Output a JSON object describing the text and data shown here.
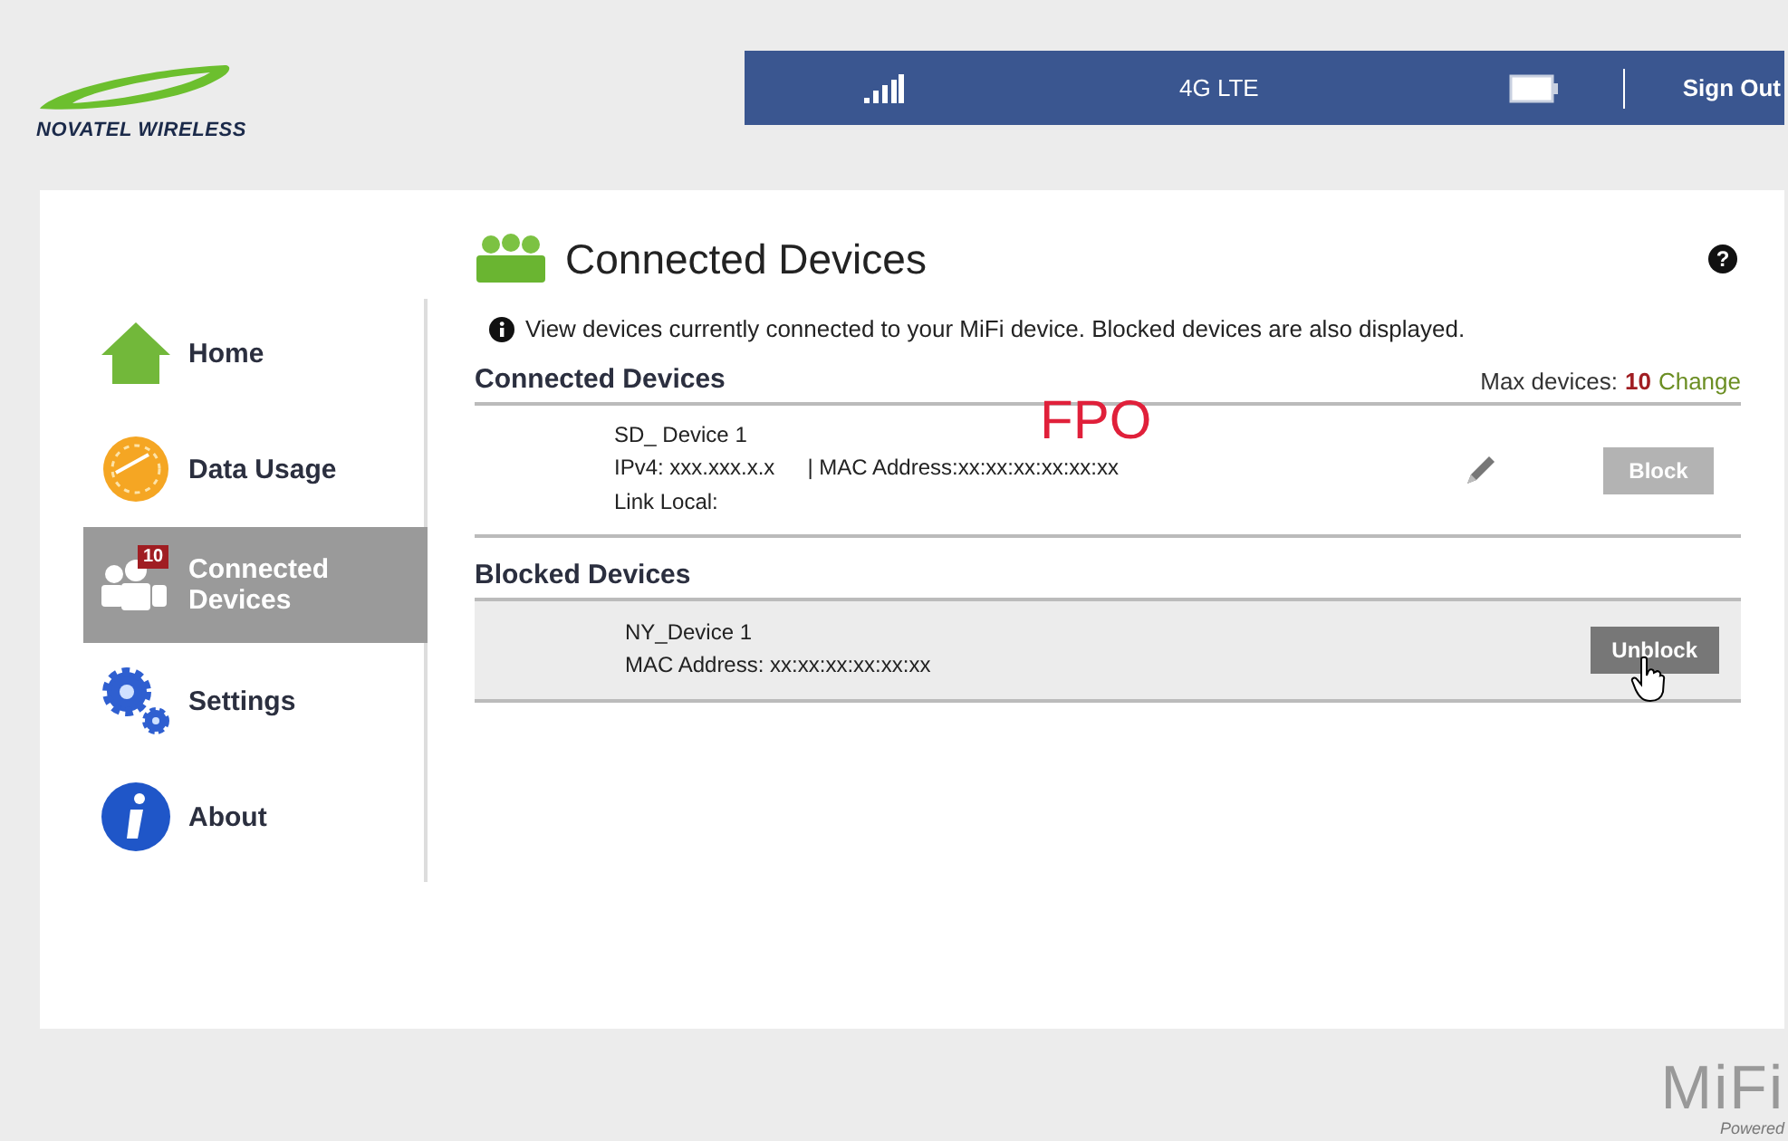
{
  "logo": {
    "text": "NOVATEL WIRELESS"
  },
  "status_bar": {
    "network": "4G LTE",
    "sign_out": "Sign Out"
  },
  "sidebar": {
    "items": [
      {
        "label": "Home",
        "kind": "home",
        "selected": false
      },
      {
        "label": "Data Usage",
        "kind": "usage",
        "selected": false
      },
      {
        "label": "Connected Devices",
        "kind": "devices",
        "selected": true,
        "badge": "10"
      },
      {
        "label": "Settings",
        "kind": "settings",
        "selected": false
      },
      {
        "label": "About",
        "kind": "about",
        "selected": false
      }
    ]
  },
  "page": {
    "title": "Connected Devices",
    "help": "?",
    "info": "View devices currently connected to your MiFi device. Blocked devices are also displayed.",
    "note": "FPO"
  },
  "connected": {
    "heading": "Connected Devices",
    "max_label": "Max devices:",
    "max_value": "10",
    "change": "Change",
    "devices": [
      {
        "name": "SD_ Device 1",
        "ipv4": "IPv4: xxx.xxx.x.x",
        "mac": "| MAC Address:xx:xx:xx:xx:xx:xx",
        "link_local": "Link Local:",
        "action": "Block",
        "disabled": true
      }
    ]
  },
  "blocked": {
    "heading": "Blocked Devices",
    "devices": [
      {
        "name": "NY_Device 1",
        "mac": "MAC Address: xx:xx:xx:xx:xx:xx",
        "action": "Unblock",
        "disabled": false
      }
    ]
  },
  "footer": {
    "brand": "MiFi",
    "tagline": "Powered"
  }
}
